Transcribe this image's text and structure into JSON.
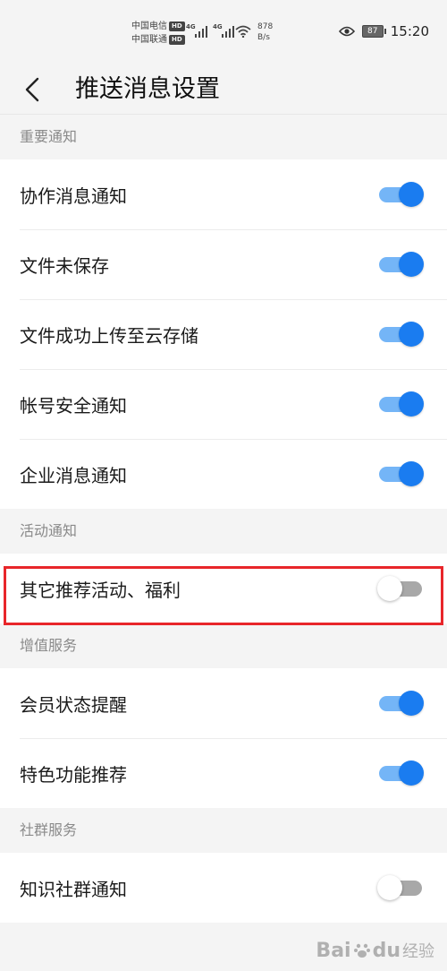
{
  "status_bar": {
    "carrier_1": "中国电信",
    "carrier_2": "中国联通",
    "hd_label": "HD",
    "network_type": "4G",
    "speed_value": "878",
    "speed_unit": "B/s",
    "battery_level": "87",
    "time": "15:20",
    "icons": [
      "signal-icon",
      "wifi-icon",
      "eye-icon",
      "battery-icon"
    ]
  },
  "header": {
    "title": "推送消息设置",
    "back_icon": "chevron-left-icon"
  },
  "sections": [
    {
      "title": "重要通知",
      "items": [
        {
          "label": "协作消息通知",
          "enabled": true
        },
        {
          "label": "文件未保存",
          "enabled": true
        },
        {
          "label": "文件成功上传至云存储",
          "enabled": true
        },
        {
          "label": "帐号安全通知",
          "enabled": true
        },
        {
          "label": "企业消息通知",
          "enabled": true
        }
      ]
    },
    {
      "title": "活动通知",
      "items": [
        {
          "label": "其它推荐活动、福利",
          "enabled": false
        }
      ]
    },
    {
      "title": "增值服务",
      "items": [
        {
          "label": "会员状态提醒",
          "enabled": true
        },
        {
          "label": "特色功能推荐",
          "enabled": true
        }
      ]
    },
    {
      "title": "社群服务",
      "items": [
        {
          "label": "知识社群通知",
          "enabled": false
        }
      ]
    }
  ],
  "colors": {
    "toggle_on_knob": "#1a7cf0",
    "toggle_on_track": "#74b5f7",
    "toggle_off_track": "#a8a8a8",
    "highlight": "#e8262a",
    "background": "#f4f4f4"
  },
  "watermark": {
    "brand": "Bai",
    "paw": "du",
    "sub": "经验"
  }
}
